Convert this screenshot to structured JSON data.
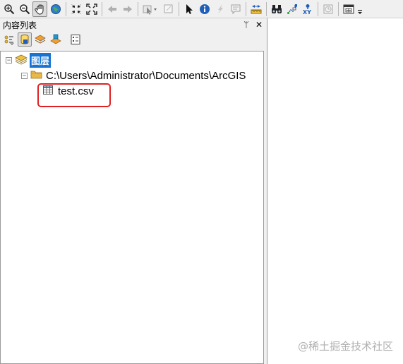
{
  "toc": {
    "title": "内容列表",
    "pin_glyph": "ᛘ",
    "close_glyph": "✕",
    "tools": [
      {
        "name": "list-by-drawing-order",
        "icon": "drawing-order-icon"
      },
      {
        "name": "list-by-source",
        "icon": "source-icon",
        "active": true
      },
      {
        "name": "list-by-visibility",
        "icon": "visibility-icon"
      },
      {
        "name": "list-by-selection",
        "icon": "selection-icon"
      },
      {
        "name": "options",
        "icon": "options-icon"
      }
    ],
    "tree": {
      "root_label": "图层",
      "folder_path": "C:\\Users\\Administrator\\Documents\\ArcGIS",
      "table_label": "test.csv",
      "expanded_glyph": "−"
    }
  },
  "toolbar": {
    "icons": [
      "zoom-in-icon",
      "zoom-out-icon",
      "pan-icon",
      "full-extent-icon",
      "fixed-zoom-in-icon",
      "fixed-zoom-out-icon",
      "back-icon",
      "forward-icon",
      "select-features-icon",
      "clear-selection-icon",
      "select-elements-icon",
      "identify-icon",
      "hyperlink-icon",
      "html-popup-icon",
      "measure-icon",
      "find-icon",
      "find-route-icon",
      "goto-xy-icon",
      "time-slider-icon",
      "create-viewer-icon"
    ]
  },
  "watermark": "@稀土掘金技术社区",
  "colors": {
    "selection_blue": "#1874d2",
    "highlight_red": "#e02020",
    "folder_yellow": "#e8b848"
  }
}
